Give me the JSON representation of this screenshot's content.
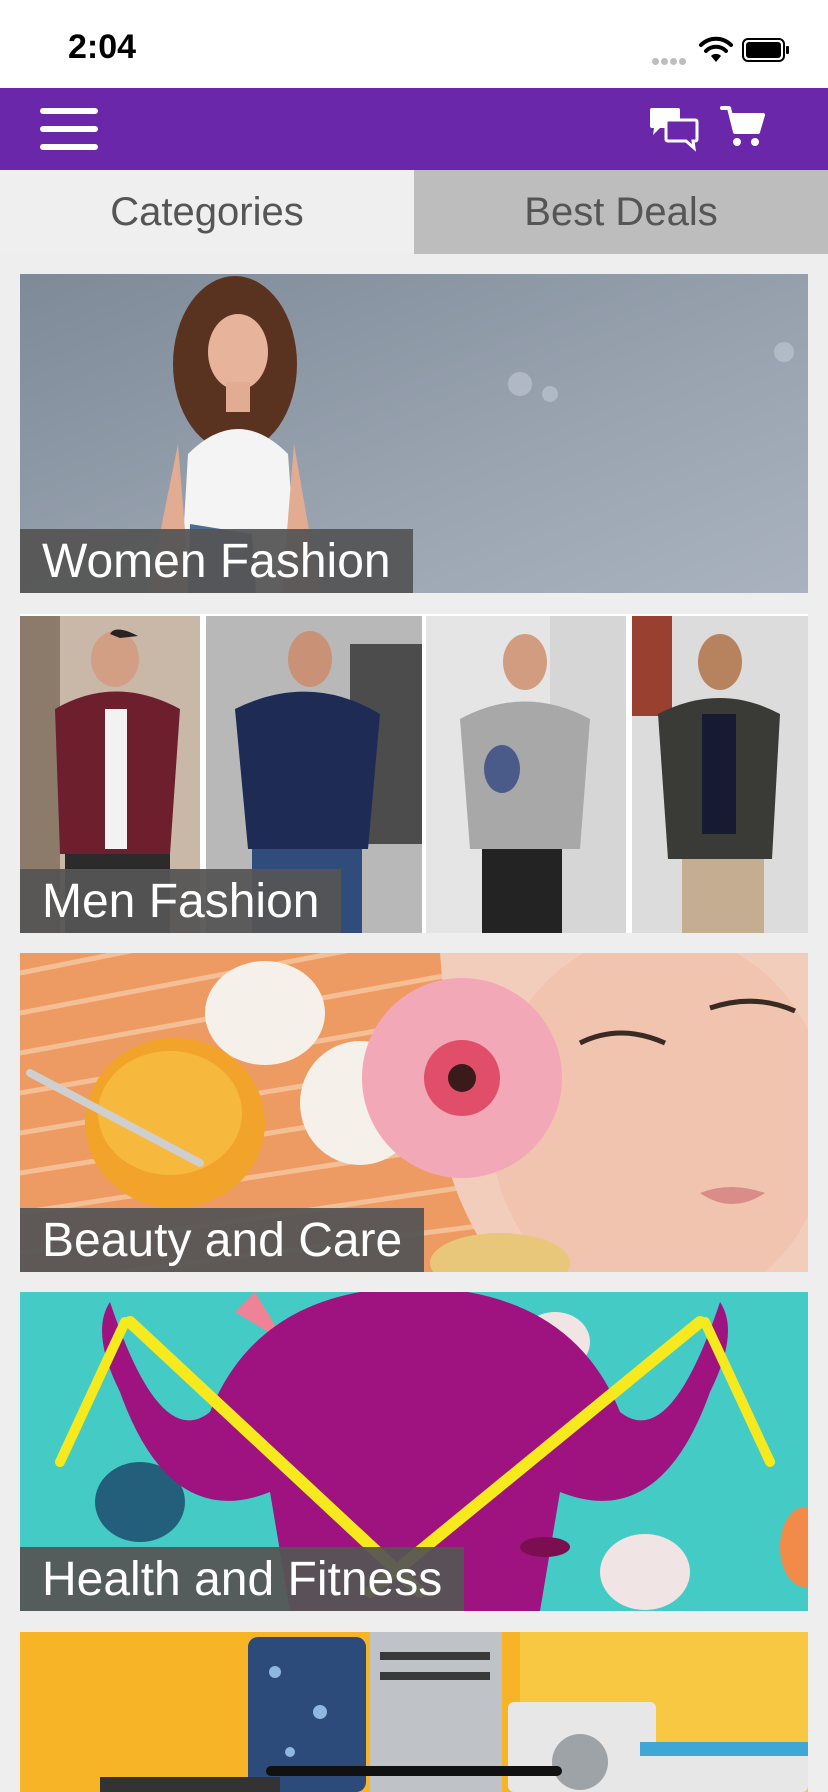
{
  "status_bar": {
    "time": "2:04"
  },
  "app_bar": {
    "menu_icon": "hamburger-menu-icon",
    "chat_icon": "chat-bubbles-icon",
    "cart_icon": "shopping-cart-icon",
    "background": "#6B27AA"
  },
  "tabs": [
    {
      "label": "Categories",
      "selected": true
    },
    {
      "label": "Best Deals",
      "selected": false
    }
  ],
  "categories": [
    {
      "label": "Women Fashion"
    },
    {
      "label": "Men Fashion"
    },
    {
      "label": "Beauty and Care"
    },
    {
      "label": "Health and Fitness"
    },
    {
      "label": ""
    }
  ],
  "colors": {
    "accent": "#6B27AA",
    "tab_inactive": "#BDBDBD",
    "label_bg": "#555555",
    "background": "#EEEEEE"
  }
}
